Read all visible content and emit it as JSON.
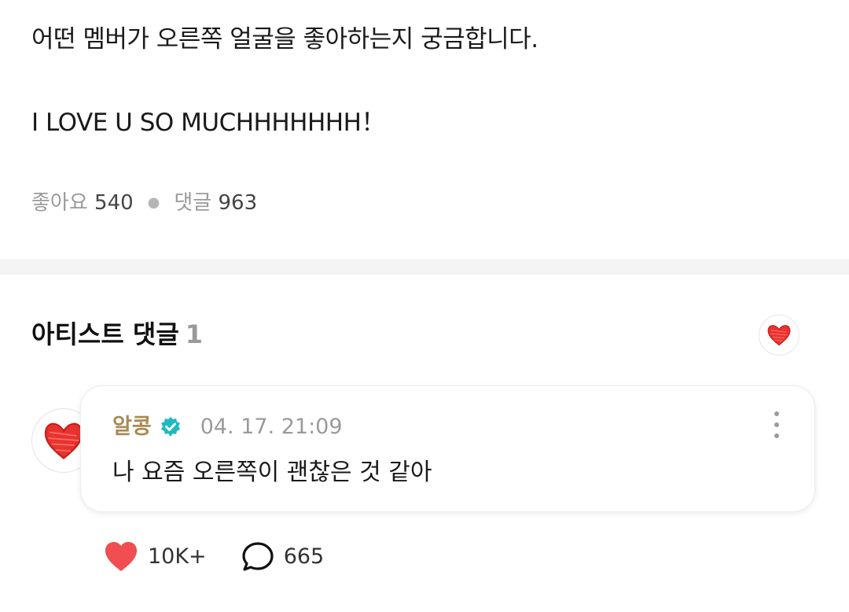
{
  "post": {
    "line1": "어떤 멤버가 오른쪽 얼굴을 좋아하는지 궁금합니다.",
    "line2": "I LOVE U SO MUCHHHHHHH！",
    "likes_label": "좋아요",
    "likes_count": "540",
    "comments_label": "댓글",
    "comments_count": "963"
  },
  "artist_comments": {
    "title": "아티스트 댓글",
    "count": "1"
  },
  "comment": {
    "author": "알콩",
    "timestamp": "04. 17. 21:09",
    "text": "나 요즘 오른쪽이 괜찮은 것 같아",
    "likes": "10K+",
    "replies": "665"
  },
  "colors": {
    "author": "#a88a55",
    "verified": "#1fb8c3",
    "heart": "#f04e50",
    "muted": "#9a9a9a"
  },
  "icons": [
    "heart-doodle-icon",
    "verified-badge-icon",
    "more-vertical-icon",
    "heart-icon",
    "comment-bubble-icon"
  ]
}
